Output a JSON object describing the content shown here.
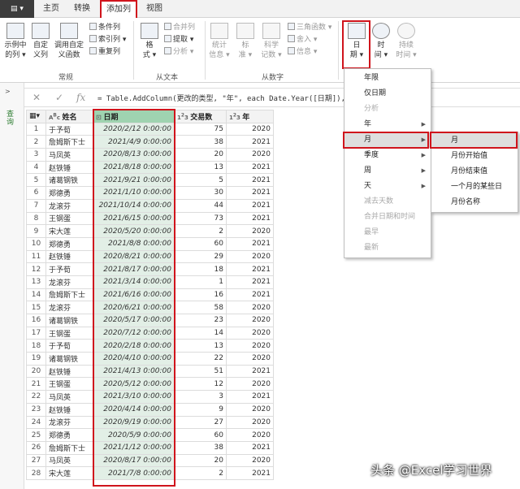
{
  "tabs": {
    "file": "▤ ▾",
    "home": "主页",
    "transform": "转换",
    "add_column": "添加列",
    "view": "视图"
  },
  "ribbon": {
    "general": {
      "example": "示例中\n的列 ▾",
      "custom": "自定\n义列",
      "invoke": "调用自定\n义函数",
      "conditional": "条件列",
      "index": "索引列 ▾",
      "duplicate": "重复列",
      "group": "常规"
    },
    "text": {
      "format": "格\n式 ▾",
      "merge": "合并列",
      "extract": "提取 ▾",
      "parse": "分析 ▾",
      "group": "从文本"
    },
    "number": {
      "stats": "统计\n信息 ▾",
      "standard": "标\n准 ▾",
      "scientific": "科学\n记数 ▾",
      "trig": "三角函数 ▾",
      "round": "舍入 ▾",
      "info": "信息 ▾",
      "group": "从数字"
    },
    "datetime": {
      "date": "日\n期 ▾",
      "time": "时\n间 ▾",
      "duration": "持续\n时间 ▾"
    }
  },
  "formula": {
    "cancel": "✕",
    "commit": "✓",
    "fx": "fx",
    "text": "= Table.AddColumn(更改的类型, \"年\", each Date.Year([日期]), In"
  },
  "left_pane_label": "查询",
  "columns": [
    "姓名",
    "日期",
    "交易数",
    "年"
  ],
  "rows": [
    [
      "于予荀",
      "2020/2/12 0:00:00",
      "75",
      "2020"
    ],
    [
      "詹姆斯下士",
      "2021/4/9 0:00:00",
      "38",
      "2021"
    ],
    [
      "马凤英",
      "2020/8/13 0:00:00",
      "20",
      "2020"
    ],
    [
      "赵铁锤",
      "2021/8/18 0:00:00",
      "13",
      "2021"
    ],
    [
      "诸葛钢铁",
      "2021/9/21 0:00:00",
      "5",
      "2021"
    ],
    [
      "郑德勇",
      "2021/1/10 0:00:00",
      "30",
      "2021"
    ],
    [
      "龙滚芬",
      "2021/10/14 0:00:00",
      "44",
      "2021"
    ],
    [
      "王钢蛋",
      "2021/6/15 0:00:00",
      "73",
      "2021"
    ],
    [
      "宋大莲",
      "2020/5/20 0:00:00",
      "2",
      "2020"
    ],
    [
      "郑德勇",
      "2021/8/8 0:00:00",
      "60",
      "2021"
    ],
    [
      "赵铁锤",
      "2020/8/21 0:00:00",
      "29",
      "2020"
    ],
    [
      "于予荀",
      "2021/8/17 0:00:00",
      "18",
      "2021"
    ],
    [
      "龙滚芬",
      "2021/3/14 0:00:00",
      "1",
      "2021"
    ],
    [
      "詹姆斯下士",
      "2021/6/16 0:00:00",
      "16",
      "2021"
    ],
    [
      "龙滚芬",
      "2020/6/21 0:00:00",
      "58",
      "2020"
    ],
    [
      "诸葛钢铁",
      "2020/5/17 0:00:00",
      "23",
      "2020"
    ],
    [
      "王钢蛋",
      "2020/7/12 0:00:00",
      "14",
      "2020"
    ],
    [
      "于予荀",
      "2020/2/18 0:00:00",
      "13",
      "2020"
    ],
    [
      "诸葛钢铁",
      "2020/4/10 0:00:00",
      "22",
      "2020"
    ],
    [
      "赵铁锤",
      "2021/4/13 0:00:00",
      "51",
      "2021"
    ],
    [
      "王钢蛋",
      "2020/5/12 0:00:00",
      "12",
      "2020"
    ],
    [
      "马凤英",
      "2021/3/10 0:00:00",
      "3",
      "2021"
    ],
    [
      "赵铁锤",
      "2020/4/14 0:00:00",
      "9",
      "2020"
    ],
    [
      "龙滚芬",
      "2020/9/19 0:00:00",
      "27",
      "2020"
    ],
    [
      "郑德勇",
      "2020/5/9 0:00:00",
      "60",
      "2020"
    ],
    [
      "詹姆斯下士",
      "2021/1/12 0:00:00",
      "38",
      "2021"
    ],
    [
      "马凤英",
      "2020/8/17 0:00:00",
      "20",
      "2020"
    ],
    [
      "宋大莲",
      "2021/7/8 0:00:00",
      "2",
      "2021"
    ]
  ],
  "date_menu": [
    "年限",
    "仅日期",
    "分析",
    "年",
    "月",
    "季度",
    "周",
    "天",
    "减去天数",
    "合并日期和时间",
    "最早",
    "最新"
  ],
  "month_menu": [
    "月",
    "月份开始值",
    "月份结束值",
    "一个月的某些日",
    "月份名称"
  ],
  "watermark": "头条 @Excel学习世界"
}
